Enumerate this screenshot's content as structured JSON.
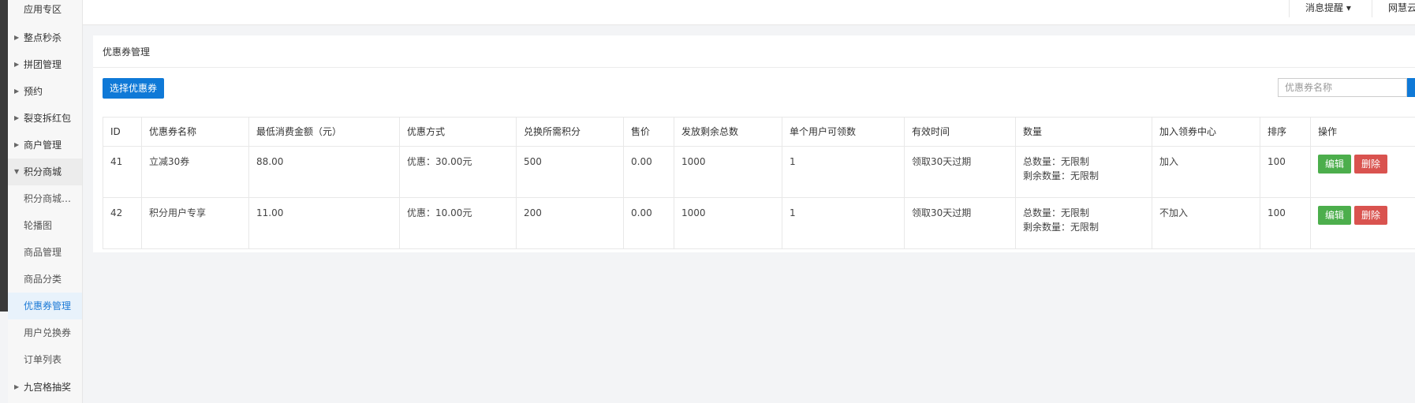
{
  "sidebar": {
    "items": [
      {
        "label": "应用专区",
        "caret": ""
      },
      {
        "label": "整点秒杀",
        "caret": "▶"
      },
      {
        "label": "拼团管理",
        "caret": "▶"
      },
      {
        "label": "预约",
        "caret": "▶"
      },
      {
        "label": "裂变拆红包",
        "caret": "▶"
      },
      {
        "label": "商户管理",
        "caret": "▶"
      },
      {
        "label": "积分商城",
        "caret": "▼"
      },
      {
        "label": "积分商城…",
        "caret": ""
      },
      {
        "label": "轮播图",
        "caret": ""
      },
      {
        "label": "商品管理",
        "caret": ""
      },
      {
        "label": "商品分类",
        "caret": ""
      },
      {
        "label": "优惠券管理",
        "caret": ""
      },
      {
        "label": "用户兑换券",
        "caret": ""
      },
      {
        "label": "订单列表",
        "caret": ""
      },
      {
        "label": "九宫格抽奖",
        "caret": "▶"
      }
    ]
  },
  "topbar": {
    "notifications": "消息提醒 ▾",
    "account": "网慧云"
  },
  "card": {
    "title": "优惠券管理",
    "select_button": "选择优惠券",
    "search_placeholder": "优惠券名称"
  },
  "table": {
    "headers": [
      "ID",
      "优惠券名称",
      "最低消费金额（元）",
      "优惠方式",
      "兑换所需积分",
      "售价",
      "发放剩余总数",
      "单个用户可领数",
      "有效时间",
      "数量",
      "加入领券中心",
      "排序",
      "操作"
    ],
    "rows": [
      {
        "id": "41",
        "name": "立减30券",
        "min": "88.00",
        "discount": "优惠：30.00元",
        "points": "500",
        "price": "0.00",
        "remain": "1000",
        "per_user": "1",
        "valid": "领取30天过期",
        "qty_total": "总数量：无限制",
        "qty_left": "剩余数量：无限制",
        "center": "加入",
        "sort": "100",
        "edit": "编辑",
        "delete": "删除"
      },
      {
        "id": "42",
        "name": "积分用户专享",
        "min": "11.00",
        "discount": "优惠：10.00元",
        "points": "200",
        "price": "0.00",
        "remain": "1000",
        "per_user": "1",
        "valid": "领取30天过期",
        "qty_total": "总数量：无限制",
        "qty_left": "剩余数量：无限制",
        "center": "不加入",
        "sort": "100",
        "edit": "编辑",
        "delete": "删除"
      }
    ]
  },
  "colors": {
    "primary": "#0f79d7",
    "edit": "#4cae4c",
    "delete": "#d9534f",
    "active_menu_text": "#1c7ad6"
  }
}
